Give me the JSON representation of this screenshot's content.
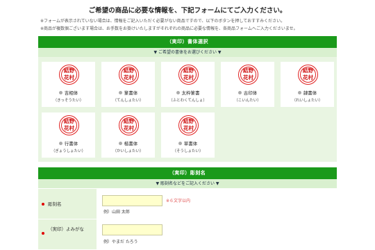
{
  "header": {
    "title": "ご希望の商品に必要な情報を、下記フォームにてご入力ください。",
    "notes": [
      "※フォームが表示されていない場合は、情報をご記入いただく必要がない商品ですので、以下のボタンを押しておすすみください。",
      "※商品が複数個ございます場合は、お手数をお掛けいたしますがそれぞれの商品に必要な情報を、各商品フォームへご入力くださいませ。"
    ]
  },
  "font_section": {
    "title": "（実印）書体選択",
    "subtitle": "▼ ご希望の書体をお選びください ▼",
    "options": [
      {
        "glyph": "結野\n花村",
        "label": "吉相体",
        "reading": "（きっそうたい）",
        "icon": "seal-kisso"
      },
      {
        "glyph": "結野\n花村",
        "label": "篆書体",
        "reading": "（てんしょたい）",
        "icon": "seal-tensho"
      },
      {
        "glyph": "結野\n花村",
        "label": "太枠篆書",
        "reading": "（ふとわくてんしょ）",
        "icon": "seal-futowaku"
      },
      {
        "glyph": "結野\n花村",
        "label": "古印体",
        "reading": "（こいんたい）",
        "icon": "seal-koin"
      },
      {
        "glyph": "結野\n花村",
        "label": "隷書体",
        "reading": "（れいしょたい）",
        "icon": "seal-reisho"
      },
      {
        "glyph": "結野\n花村",
        "label": "行書体",
        "reading": "（ぎょうしょたい）",
        "icon": "seal-gyosho"
      },
      {
        "glyph": "結野\n花村",
        "label": "楷書体",
        "reading": "（かいしょたい）",
        "icon": "seal-kaisho"
      },
      {
        "glyph": "結野\n花村",
        "label": "草書体",
        "reading": "（そうしょたい）",
        "icon": "seal-sosho"
      }
    ]
  },
  "engrave_section": {
    "title": "（実印）彫刻名",
    "subtitle": "▼ 彫刻名などをご記入ください ▼",
    "name_field": {
      "label": "彫刻名",
      "value": "",
      "limit": "※６文字以内",
      "example": "例）山田 太郎"
    },
    "reading_field": {
      "label": "（実印）よみがな",
      "value": "",
      "example": "例）やまだ たろう"
    }
  },
  "colors": {
    "accent_green": "#1a9a1a",
    "light_green": "#d9f0cf",
    "seal_red": "#e02020",
    "required_dot": "#e00000"
  }
}
